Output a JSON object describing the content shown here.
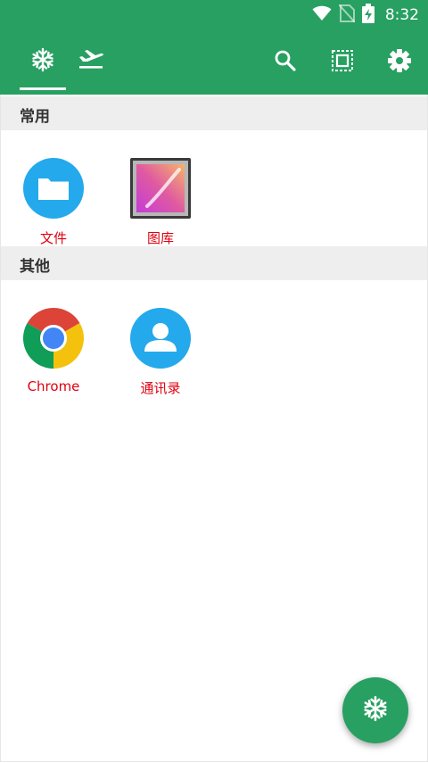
{
  "status_bar": {
    "time": "8:32",
    "icons": [
      "wifi-icon",
      "no-sim-icon",
      "battery-charging-icon"
    ]
  },
  "toolbar": {
    "tabs": [
      {
        "icon": "snowflake-icon",
        "selected": true
      },
      {
        "icon": "airplane-icon",
        "selected": false
      }
    ],
    "actions": [
      "search-icon",
      "select-all-icon",
      "settings-gear-icon"
    ]
  },
  "sections": [
    {
      "title": "常用",
      "apps": [
        {
          "label": "文件",
          "icon": "files-folder-icon"
        },
        {
          "label": "图库",
          "icon": "gallery-icon"
        }
      ]
    },
    {
      "title": "其他",
      "apps": [
        {
          "label": "Chrome",
          "icon": "chrome-icon"
        },
        {
          "label": "通讯录",
          "icon": "contacts-icon"
        }
      ]
    }
  ],
  "fab": {
    "icon": "snowflake-icon"
  },
  "colors": {
    "primary": "#27a061",
    "section_bg": "#eeeeee",
    "label": "#e0000f"
  }
}
